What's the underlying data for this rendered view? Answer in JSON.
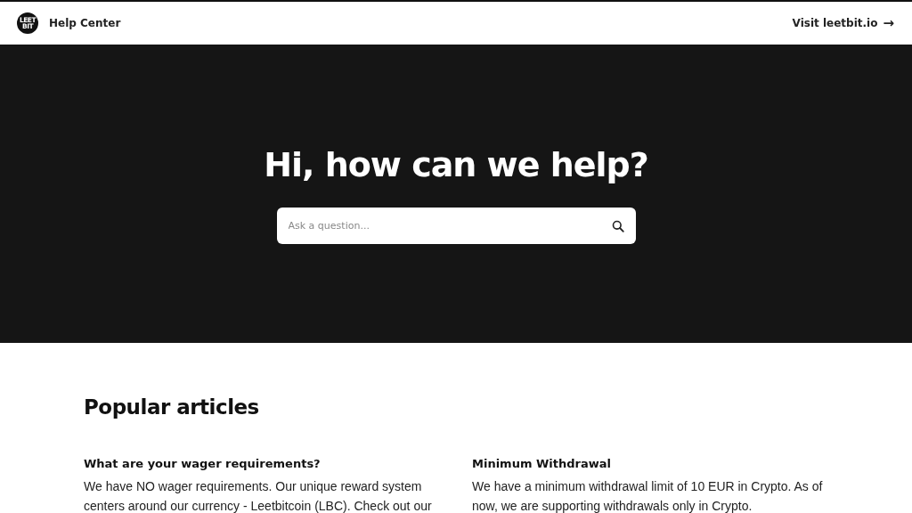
{
  "header": {
    "logo_text": [
      "LEET",
      "BIT"
    ],
    "title": "Help Center",
    "link": "Visit leetbit.io",
    "link_arrow": "→"
  },
  "hero": {
    "heading": "Hi, how can we help?",
    "search": {
      "placeholder": "Ask a question..."
    }
  },
  "popular": {
    "heading": "Popular articles",
    "articles": [
      {
        "title": "What are your wager requirements?",
        "excerpt": "We have NO wager requirements. Our unique reward system centers around our currency - Leetbitcoin (LBC). Check out our"
      },
      {
        "title": "Minimum Withdrawal",
        "excerpt": "We have a minimum withdrawal limit of 10 EUR in Crypto. As of now, we are supporting withdrawals only in Crypto."
      }
    ]
  }
}
